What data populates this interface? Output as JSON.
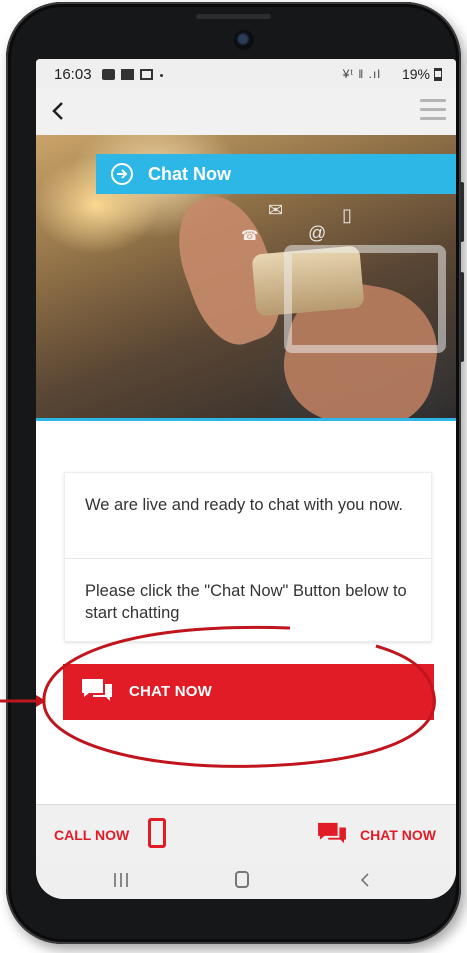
{
  "status_bar": {
    "time": "16:03",
    "signal_text": "¥ᵗ ‖ .ıl",
    "battery_percent": "19%"
  },
  "header": {
    "back_icon": "chevron-left-icon",
    "menu_icon": "hamburger-menu-icon"
  },
  "hero": {
    "banner_label": "Chat Now",
    "banner_icon": "circle-arrow-right-icon"
  },
  "card": {
    "message_1": "We are live and ready to chat with you now.",
    "message_2": "Please click the \"Chat Now\" Button below to start chatting"
  },
  "chat_button": {
    "label": "CHAT NOW",
    "icon": "chat-bubbles-icon"
  },
  "bottom_nav": {
    "call_label": "CALL NOW",
    "call_icon": "mobile-phone-icon",
    "chat_label": "CHAT NOW",
    "chat_icon": "chat-bubbles-icon"
  },
  "colors": {
    "brand_red": "#e21c26",
    "banner_blue": "#2cb7e6",
    "annotation_red": "#c0151d"
  }
}
